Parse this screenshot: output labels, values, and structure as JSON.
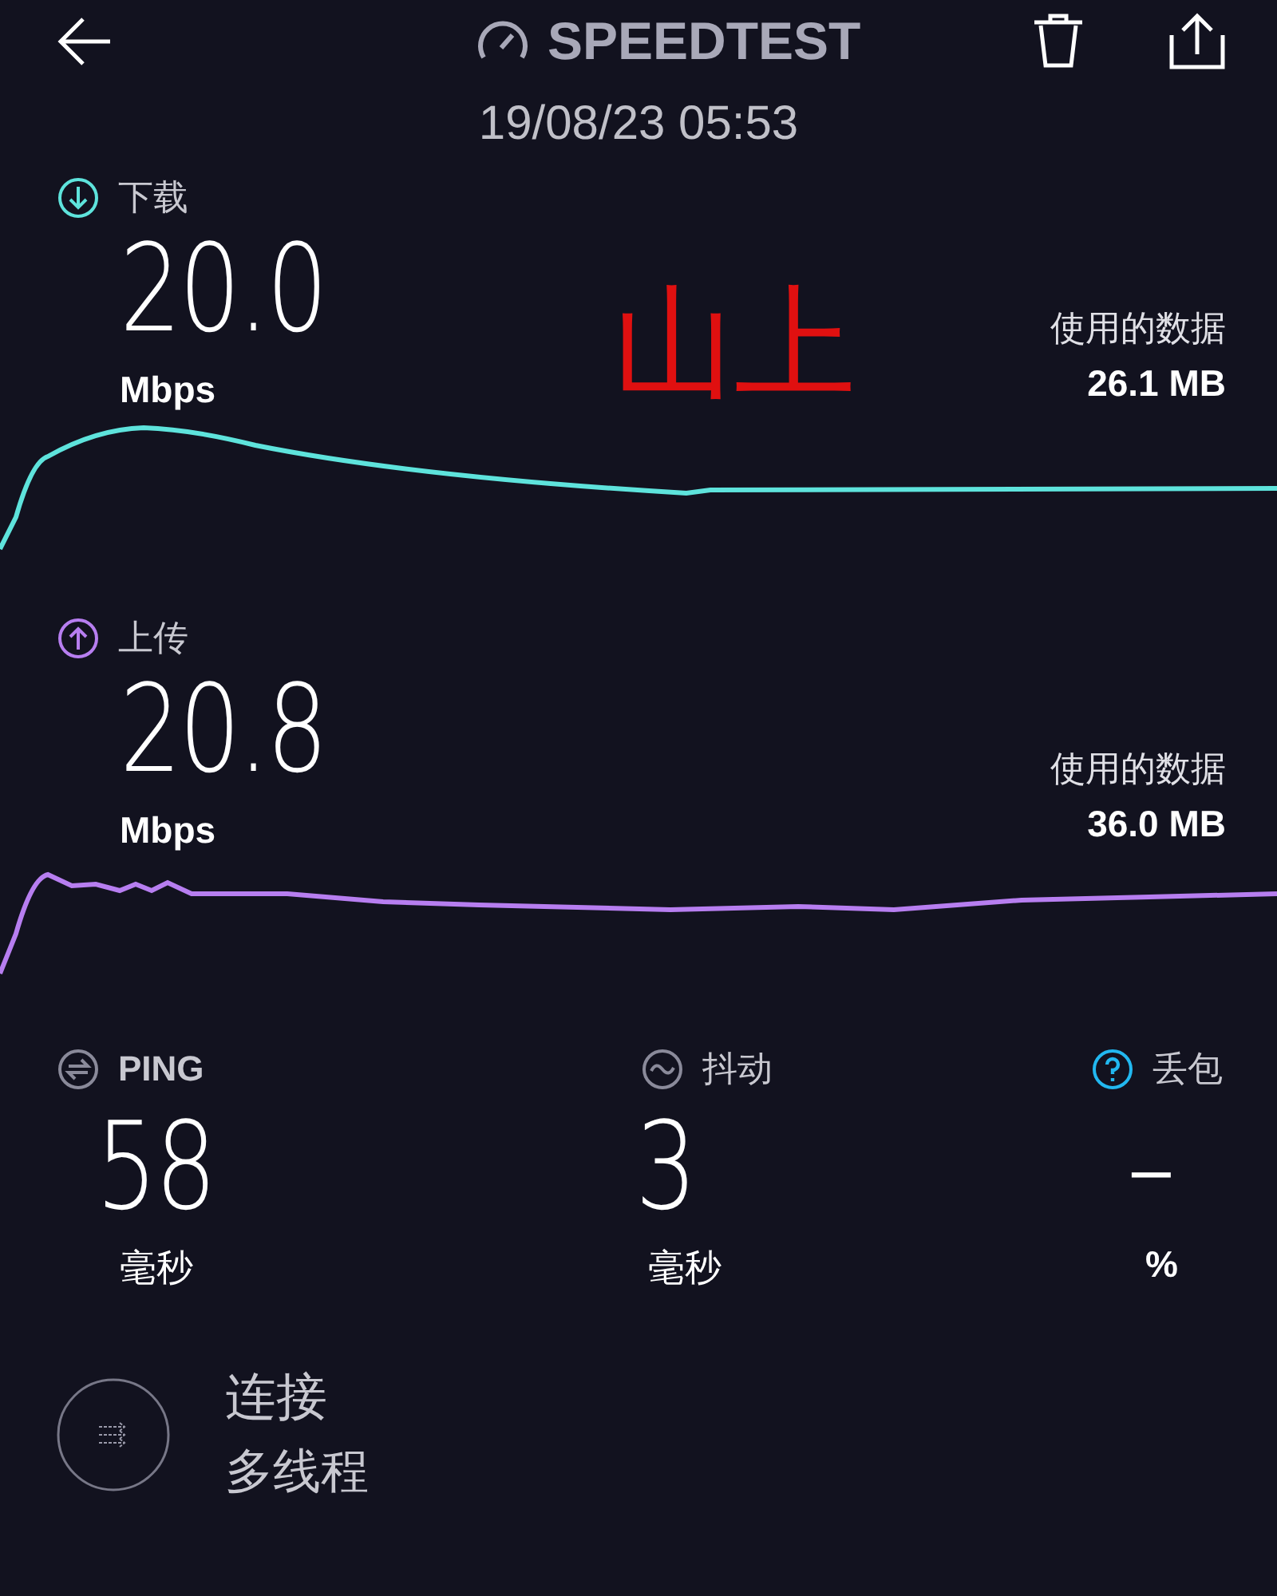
{
  "header": {
    "title": "SPEEDTEST",
    "timestamp": "19/08/23 05:53"
  },
  "annotation": {
    "text": "山上"
  },
  "tests": [
    {
      "kind": "download",
      "label": "下载",
      "value": "20.0",
      "unit": "Mbps",
      "data_label": "使用的数据",
      "data_value": "26.1 MB",
      "color": "#5ee3dc"
    },
    {
      "kind": "upload",
      "label": "上传",
      "value": "20.8",
      "unit": "Mbps",
      "data_label": "使用的数据",
      "data_value": "36.0 MB",
      "color": "#b77ef0"
    }
  ],
  "metrics": [
    {
      "kind": "ping",
      "label": "PING",
      "value": "58",
      "unit": "毫秒"
    },
    {
      "kind": "jitter",
      "label": "抖动",
      "value": "3",
      "unit": "毫秒"
    },
    {
      "kind": "loss",
      "label": "丢包",
      "value": "–",
      "unit": "%"
    }
  ],
  "connection": {
    "label": "连接",
    "value": "多线程"
  }
}
